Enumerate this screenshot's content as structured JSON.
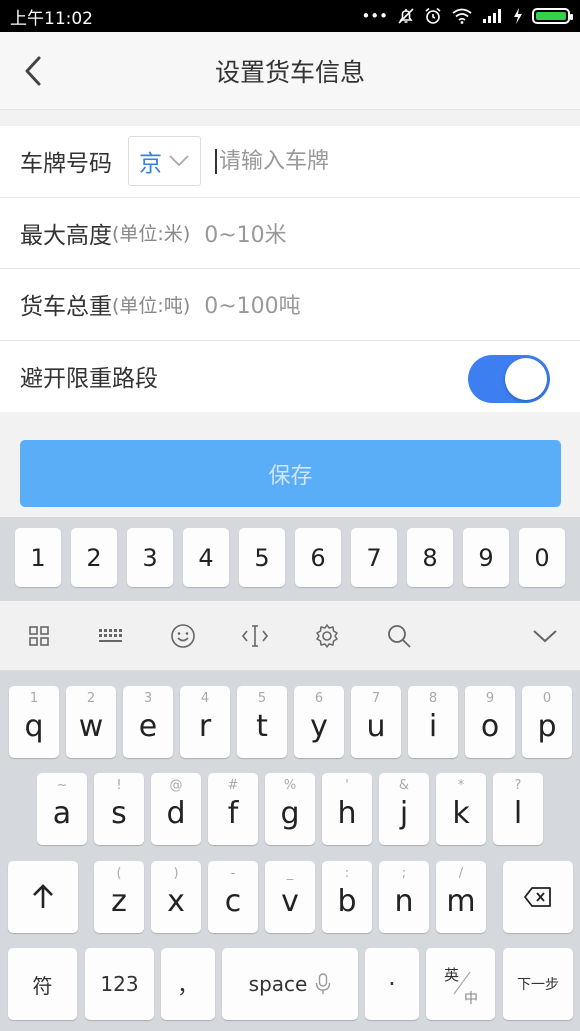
{
  "status_bar": {
    "time": "上午11:02",
    "icons": [
      "dots-icon",
      "silent-icon",
      "alarm-icon",
      "wifi-icon",
      "signal-icon",
      "charge-icon",
      "battery-icon"
    ]
  },
  "header": {
    "title": "设置货车信息"
  },
  "form": {
    "plate": {
      "label": "车牌号码",
      "province": "京",
      "placeholder": "请输入车牌"
    },
    "height": {
      "label": "最大高度",
      "unit": "(单位:米)",
      "placeholder": "0~10米"
    },
    "weight": {
      "label": "货车总重",
      "unit": "(单位:吨)",
      "placeholder": "0~100吨"
    },
    "avoid": {
      "label": "避开限重路段",
      "enabled": true
    }
  },
  "save_button": "保存",
  "colors": {
    "accent": "#3d7ef0",
    "save_bg": "#5aaef7",
    "province_text": "#3a7ee6"
  },
  "keyboard": {
    "numbers": [
      "1",
      "2",
      "3",
      "4",
      "5",
      "6",
      "7",
      "8",
      "9",
      "0"
    ],
    "row1": [
      {
        "hint": "1",
        "ch": "q"
      },
      {
        "hint": "2",
        "ch": "w"
      },
      {
        "hint": "3",
        "ch": "e"
      },
      {
        "hint": "4",
        "ch": "r"
      },
      {
        "hint": "5",
        "ch": "t"
      },
      {
        "hint": "6",
        "ch": "y"
      },
      {
        "hint": "7",
        "ch": "u"
      },
      {
        "hint": "8",
        "ch": "i"
      },
      {
        "hint": "9",
        "ch": "o"
      },
      {
        "hint": "0",
        "ch": "p"
      }
    ],
    "row2": [
      {
        "hint": "~",
        "ch": "a"
      },
      {
        "hint": "!",
        "ch": "s"
      },
      {
        "hint": "@",
        "ch": "d"
      },
      {
        "hint": "#",
        "ch": "f"
      },
      {
        "hint": "%",
        "ch": "g"
      },
      {
        "hint": "'",
        "ch": "h"
      },
      {
        "hint": "&",
        "ch": "j"
      },
      {
        "hint": "*",
        "ch": "k"
      },
      {
        "hint": "?",
        "ch": "l"
      }
    ],
    "row3": [
      {
        "hint": "(",
        "ch": "z"
      },
      {
        "hint": ")",
        "ch": "x"
      },
      {
        "hint": "-",
        "ch": "c"
      },
      {
        "hint": "_",
        "ch": "v"
      },
      {
        "hint": ":",
        "ch": "b"
      },
      {
        "hint": ";",
        "ch": "n"
      },
      {
        "hint": "/",
        "ch": "m"
      }
    ],
    "symbols_label": "符",
    "num_label": "123",
    "comma_label": "，",
    "space_label": "space",
    "period_label": "·",
    "lang_top": "英",
    "lang_bottom": "中",
    "next_label": "下一步"
  }
}
